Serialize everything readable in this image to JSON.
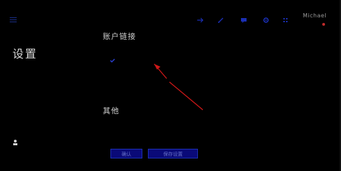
{
  "header": {
    "menu_icon": "hamburger-icon",
    "toolbar_icons": [
      "arrow-icon",
      "pencil-icon",
      "chat-icon",
      "gear-icon",
      "grid-icon"
    ],
    "user_name": "Michael",
    "user_sub": "",
    "accent": "#1d2fb0"
  },
  "sidebar": {
    "page_title": "设置",
    "account_label": ""
  },
  "main": {
    "section1_title": "账户链接",
    "checkbox_label": "",
    "section2_title": "其他",
    "hints": [
      "",
      ""
    ]
  },
  "buttons": {
    "ok_label": "确认",
    "save_label": "保存设置"
  },
  "annotation": {
    "arrow_color": "#d01818"
  }
}
